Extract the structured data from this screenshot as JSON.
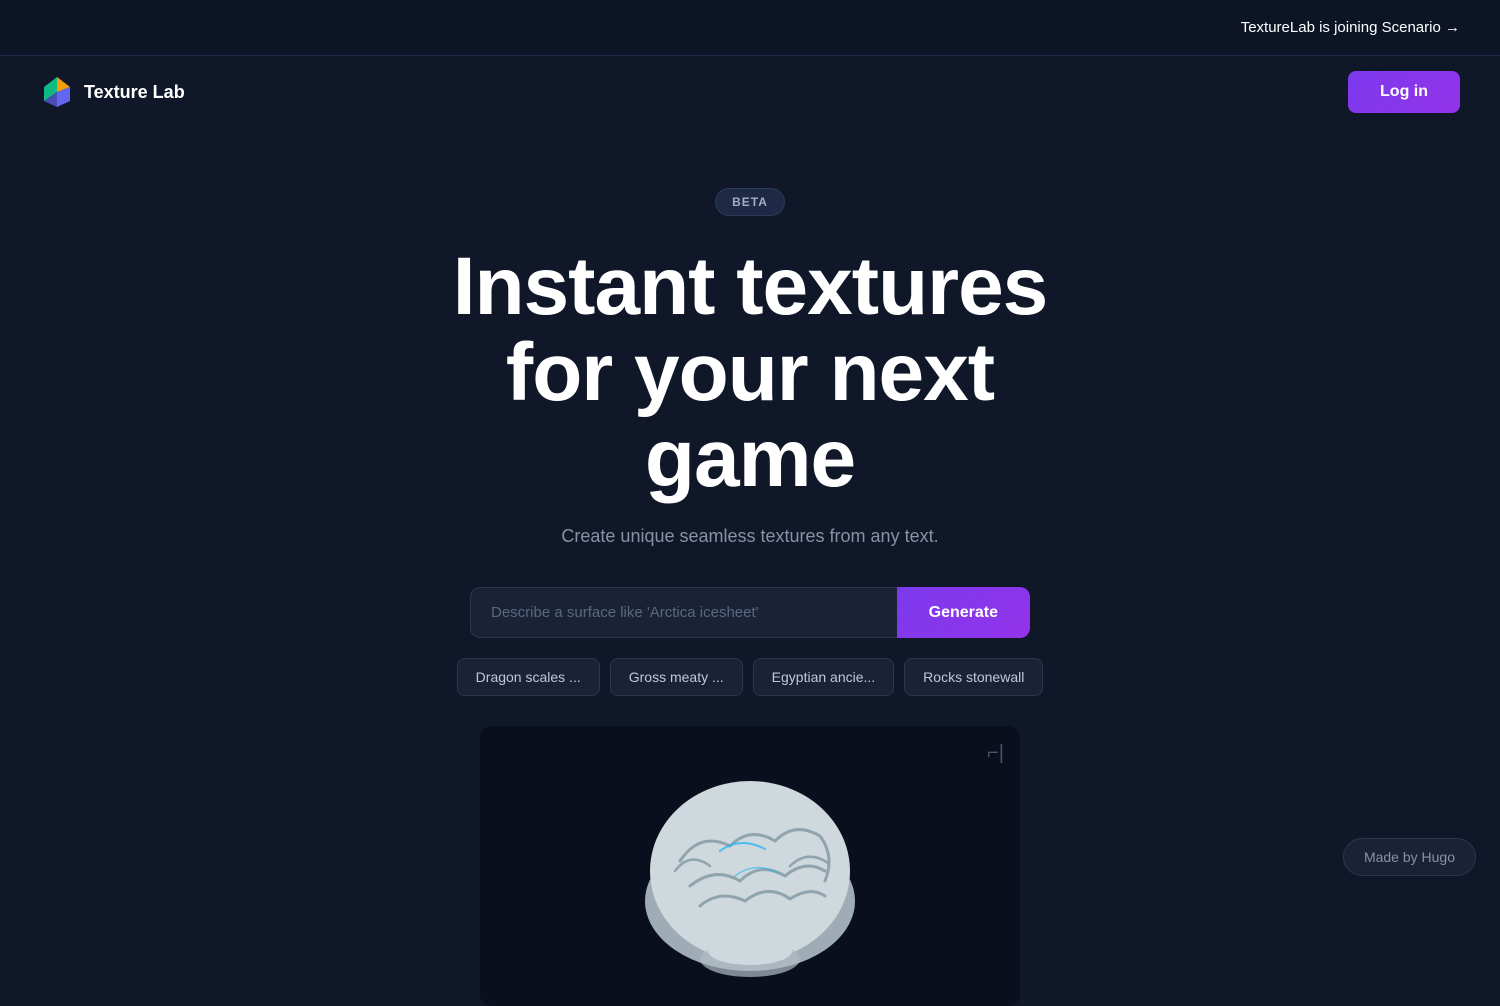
{
  "topBar": {
    "announcement": "TextureLab is joining Scenario →",
    "arrow": "→"
  },
  "nav": {
    "logoText": "Texture Lab",
    "loginLabel": "Log in"
  },
  "hero": {
    "betaLabel": "BETA",
    "title": "Instant textures for your next game",
    "subtitle": "Create unique seamless textures from any text.",
    "inputPlaceholder": "Describe a surface like 'Arctica icesheet'",
    "generateLabel": "Generate"
  },
  "chips": [
    {
      "label": "Dragon scales ..."
    },
    {
      "label": "Gross meaty ..."
    },
    {
      "label": "Egyptian ancie..."
    },
    {
      "label": "Rocks stonewall"
    }
  ],
  "preview": {
    "cornerSymbol": "⌐|"
  },
  "footer": {
    "madeBy": "Made by Hugo"
  }
}
